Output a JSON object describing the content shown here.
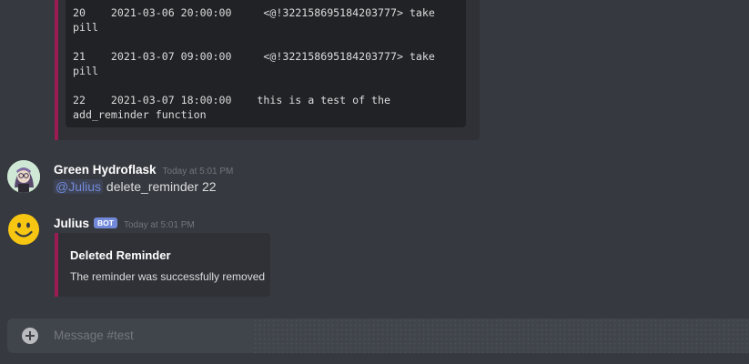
{
  "code_embed": {
    "lines": [
      {
        "l1": "20    2021-03-06 20:00:00     <@!322158695184203777> take",
        "l2": "pill"
      },
      {
        "l1": "21    2021-03-07 09:00:00     <@!322158695184203777> take",
        "l2": "pill"
      },
      {
        "l1": "22    2021-03-07 18:00:00    this is a test of the",
        "l2": "add_reminder function"
      }
    ]
  },
  "messages": [
    {
      "username": "Green Hydroflask",
      "timestamp": "Today at 5:01 PM",
      "mention": "@Julius",
      "text": " delete_reminder 22"
    },
    {
      "username": "Julius",
      "bot_tag": "BOT",
      "timestamp": "Today at 5:01 PM",
      "embed": {
        "title": "Deleted Reminder",
        "description": "The reminder was successfully removed"
      }
    }
  ],
  "input": {
    "placeholder": "Message #test",
    "add_icon": "plus-circle-icon"
  },
  "colors": {
    "embed_accent": "#9b1c53",
    "mention": "#7289da",
    "bot_tag": "#7289da"
  }
}
